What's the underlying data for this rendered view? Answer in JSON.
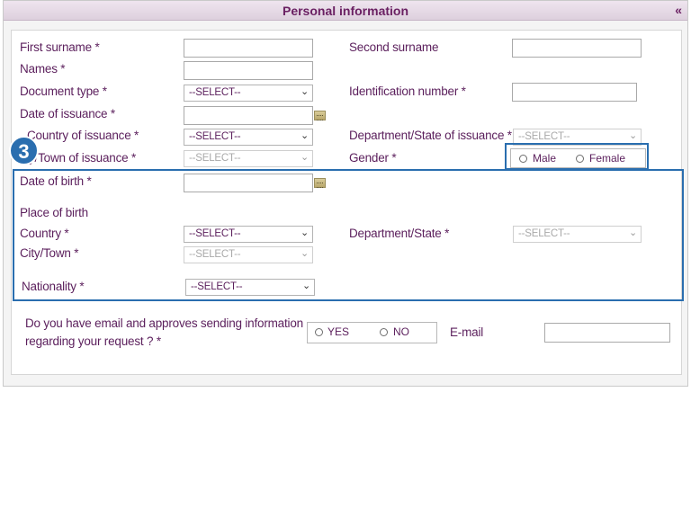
{
  "header": {
    "title": "Personal information",
    "collapse_icon": "«"
  },
  "step_badge": "3",
  "fields": {
    "first_surname_label": "First surname *",
    "second_surname_label": "Second surname",
    "names_label": "Names *",
    "document_type_label": "Document type *",
    "document_type_value": "--SELECT--",
    "identification_number_label": "Identification number *",
    "date_of_issuance_label": "Date of issuance *",
    "country_of_issuance_label": "Country of issuance *",
    "country_of_issuance_value": "--SELECT--",
    "department_issuance_label": "Department/State of issuance *",
    "department_issuance_value": "--SELECT--",
    "city_issuance_label": "y/Town of issuance *",
    "city_issuance_value": "--SELECT--",
    "gender_label": "Gender *",
    "gender_options": [
      "Male",
      "Female"
    ],
    "date_of_birth_label": "Date of birth *",
    "place_of_birth_label": "Place of birth",
    "country_label": "Country *",
    "country_value": "--SELECT--",
    "department_state_label": "Department/State *",
    "department_state_value": "--SELECT--",
    "city_town_label": "City/Town *",
    "city_town_value": "--SELECT--",
    "nationality_label": "Nationality *",
    "nationality_value": "--SELECT--",
    "email_question_line1": "Do you have email and approves sending information",
    "email_question_line2": "regarding your request ? *",
    "email_options": [
      "YES",
      "NO"
    ],
    "email_label": "E-mail"
  },
  "colors": {
    "label_purple": "#5b1f5c",
    "highlight_blue": "#2a6eaf"
  }
}
